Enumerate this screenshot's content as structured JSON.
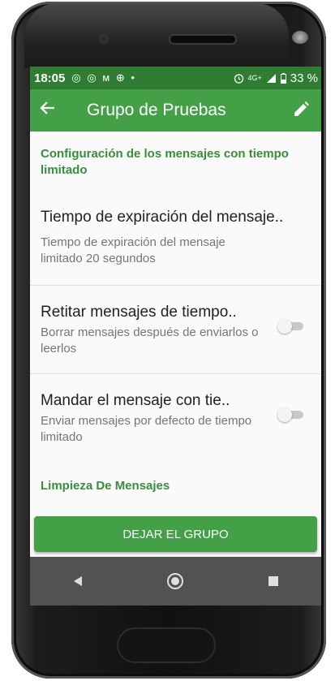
{
  "status_bar": {
    "time": "18:05",
    "notification_icons": "◎ ◎ ᴍ ⊕ •",
    "alarm_icon": "alarm-icon",
    "network": "4G+",
    "battery_percent": "33 %"
  },
  "app_bar": {
    "title": "Grupo de Pruebas",
    "back_icon": "arrow-back-icon",
    "edit_icon": "pencil-icon"
  },
  "sections": {
    "timed_messages_header": "Configuración de los mensajes con tiempo limitado",
    "cleanup_header": "Limpieza De Mensajes"
  },
  "preferences": [
    {
      "title": "Tiempo de expiración del mensaje..",
      "summary": "Tiempo de expiración del mensaje limitado 20 segundos",
      "has_toggle": false
    },
    {
      "title": "Retitar mensajes de tiempo..",
      "summary": "Borrar mensajes después de enviarlos o leerlos",
      "has_toggle": true,
      "toggle_on": false
    },
    {
      "title": "Mandar el mensaje con tie..",
      "summary": "Enviar mensajes por defecto de tiempo limitado",
      "has_toggle": true,
      "toggle_on": false
    }
  ],
  "leave_button": "DEJAR EL GRUPO",
  "nav_bar": [
    "back-triangle-icon",
    "home-circle-icon",
    "recents-square-icon"
  ],
  "colors": {
    "status_bar": "#2e7d32",
    "app_bar": "#43a047",
    "section_header": "#388e3c",
    "nav_bar": "#525252"
  }
}
